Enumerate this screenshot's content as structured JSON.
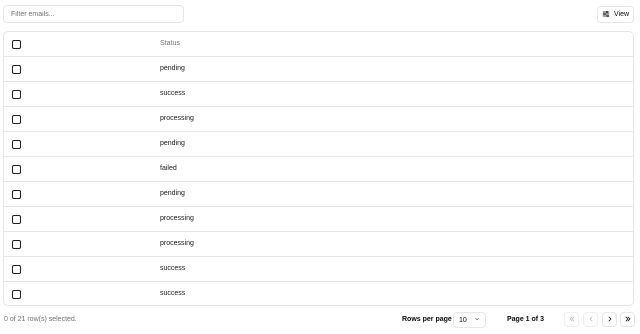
{
  "filter": {
    "placeholder": "Filter emails..."
  },
  "view_button": {
    "label": "View",
    "icon": "sliders-icon"
  },
  "table": {
    "header": {
      "status": "Status"
    },
    "rows": [
      {
        "status": "pending"
      },
      {
        "status": "success"
      },
      {
        "status": "processing"
      },
      {
        "status": "pending"
      },
      {
        "status": "failed"
      },
      {
        "status": "pending"
      },
      {
        "status": "processing"
      },
      {
        "status": "processing"
      },
      {
        "status": "success"
      },
      {
        "status": "success"
      }
    ]
  },
  "footer": {
    "selected_text": "0 of 21 row(s) selected.",
    "rows_per_page_label": "Rows per page",
    "rows_per_page_value": "10",
    "page_info": "Page 1 of 3"
  },
  "pagination": {
    "first": {
      "icon": "chevrons-left-icon",
      "enabled": false
    },
    "prev": {
      "icon": "chevron-left-icon",
      "enabled": false
    },
    "next": {
      "icon": "chevron-right-icon",
      "enabled": true
    },
    "last": {
      "icon": "chevrons-right-icon",
      "enabled": true
    }
  },
  "colors": {
    "border": "#e5e7eb",
    "muted": "#737373",
    "text": "#0a0a0a"
  }
}
